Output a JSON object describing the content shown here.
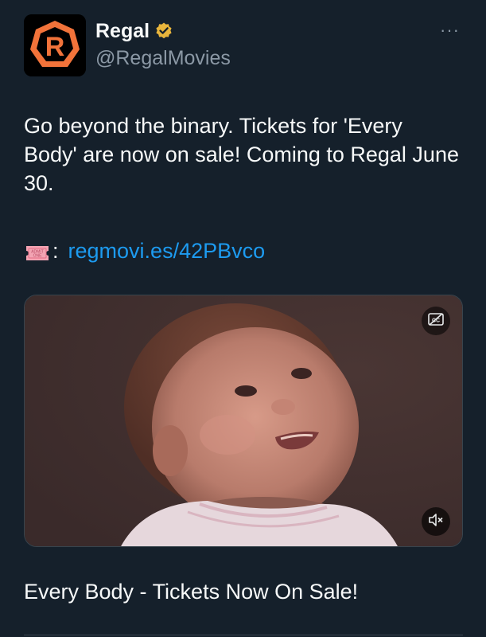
{
  "author": {
    "display_name": "Regal",
    "handle": "@RegalMovies",
    "verified": true,
    "avatar_letter": "R",
    "avatar_color": "#f2733a",
    "verified_color": "#e8b53c"
  },
  "menu": {
    "more_label": "···"
  },
  "tweet": {
    "text": "Go beyond the binary. Tickets for 'Every Body' are now on sale! Coming to Regal June 30.",
    "link_prefix": ":",
    "link_text": "regmovi.es/42PBvco",
    "link_color": "#1d9bf0",
    "ticket_emoji_text": "ADMIT ONE"
  },
  "media": {
    "type": "video",
    "subject": "baby-portrait",
    "cc_icon": "closed-captions-off-icon",
    "mute_icon": "speaker-muted-icon"
  },
  "card": {
    "title": "Every Body - Tickets Now On Sale!"
  },
  "colors": {
    "background": "#15202b",
    "text_primary": "#f7f9f9",
    "text_secondary": "#8b98a5",
    "border": "#38444d"
  }
}
